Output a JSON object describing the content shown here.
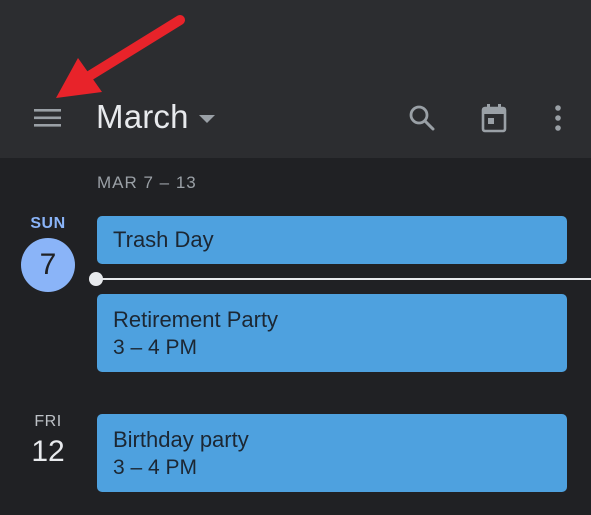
{
  "header": {
    "month": "March"
  },
  "icons": {
    "menu": "menu-icon",
    "search": "search-icon",
    "today": "calendar-today-icon",
    "more": "more-vert-icon",
    "dropdown": "chevron-down-icon",
    "annotation": "red-arrow-icon"
  },
  "week": {
    "range": "MAR 7 – 13"
  },
  "days": [
    {
      "dow": "SUN",
      "date": "7",
      "events": [
        {
          "title": "Trash Day"
        },
        {
          "title": "Retirement Party",
          "time": "3 – 4 PM"
        }
      ]
    },
    {
      "dow": "FRI",
      "date": "12",
      "events": [
        {
          "title": "Birthday party",
          "time": "3 – 4 PM"
        }
      ]
    }
  ],
  "colors": {
    "background": "#202124",
    "toolbar": "#2c2d30",
    "accent": "#8ab4f8",
    "event": "#4ea1df",
    "arrow": "#e8232a"
  }
}
